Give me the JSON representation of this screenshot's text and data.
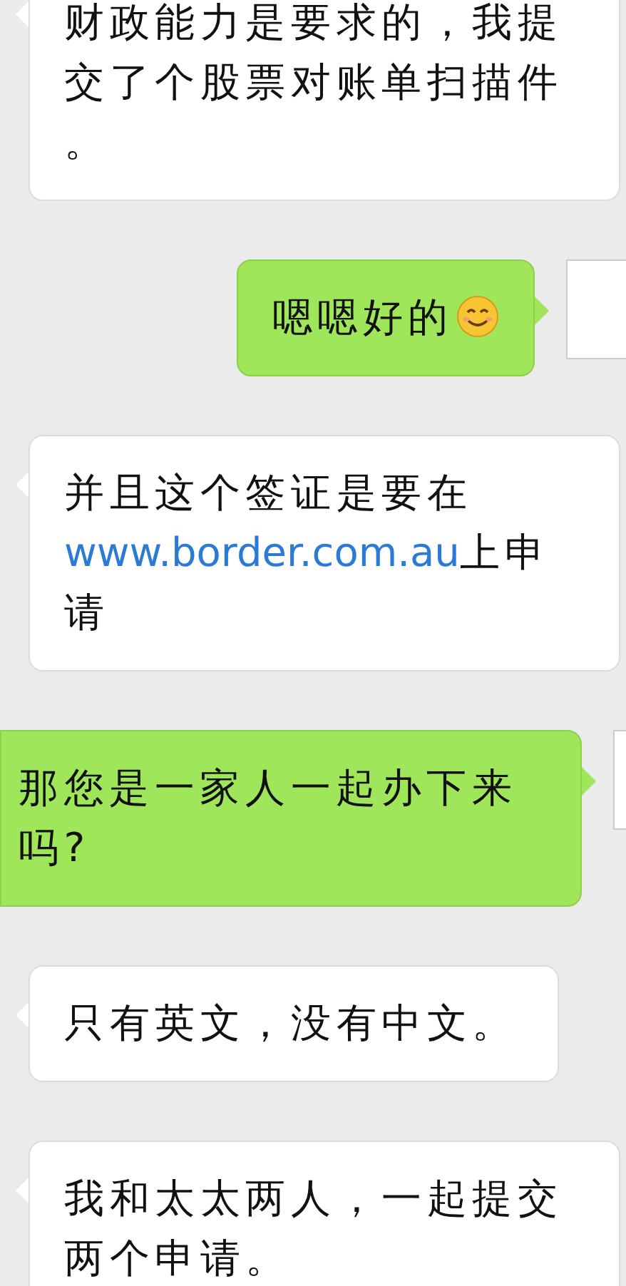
{
  "messages": [
    {
      "kind": "incoming",
      "parts": [
        {
          "kind": "text",
          "text": "财政能力是要求的，我提交了个股票对账单扫描件。"
        }
      ]
    },
    {
      "kind": "outgoing",
      "parts": [
        {
          "kind": "text",
          "text": "嗯嗯好的"
        },
        {
          "kind": "emoji"
        }
      ]
    },
    {
      "kind": "incoming",
      "parts": [
        {
          "kind": "text",
          "text": "并且这个签证是要在"
        },
        {
          "kind": "link",
          "text": "www.border.com.au"
        },
        {
          "kind": "text",
          "text": "上申请"
        }
      ]
    },
    {
      "kind": "outgoing",
      "parts": [
        {
          "kind": "text",
          "text": "那您是一家人一起办下来吗?"
        }
      ]
    },
    {
      "kind": "incoming",
      "parts": [
        {
          "kind": "text",
          "text": "只有英文，没有中文。"
        }
      ]
    },
    {
      "kind": "incoming",
      "parts": [
        {
          "kind": "text",
          "text": "我和太太两人，一起提交两个申请。"
        }
      ]
    }
  ]
}
